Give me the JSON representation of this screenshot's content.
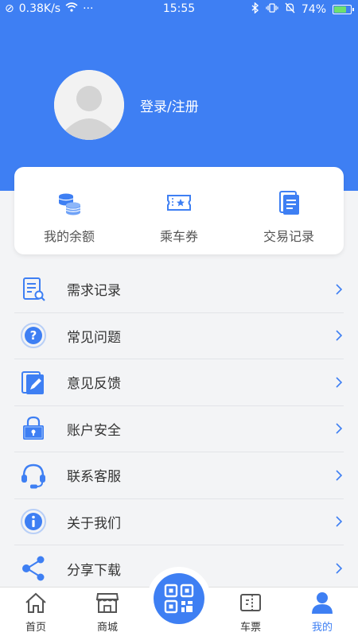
{
  "status_bar": {
    "speed": "0.38K/s",
    "time": "15:55",
    "battery": "74%",
    "battery_level": 0.74
  },
  "profile": {
    "login_label": "登录/注册"
  },
  "wallet": [
    {
      "label": "我的余额",
      "icon": "coins-icon"
    },
    {
      "label": "乘车券",
      "icon": "ticket-icon"
    },
    {
      "label": "交易记录",
      "icon": "document-icon"
    }
  ],
  "menu": [
    {
      "label": "需求记录",
      "icon": "search-document-icon"
    },
    {
      "label": "常见问题",
      "icon": "question-icon"
    },
    {
      "label": "意见反馈",
      "icon": "edit-icon"
    },
    {
      "label": "账户安全",
      "icon": "lock-icon"
    },
    {
      "label": "联系客服",
      "icon": "headset-icon"
    },
    {
      "label": "关于我们",
      "icon": "info-icon"
    },
    {
      "label": "分享下载",
      "icon": "share-icon"
    }
  ],
  "tabs": [
    {
      "label": "首页",
      "icon": "home-icon"
    },
    {
      "label": "商城",
      "icon": "store-icon"
    },
    {
      "label": "车票",
      "icon": "ticket-icon"
    },
    {
      "label": "我的",
      "icon": "user-icon",
      "active": true
    }
  ],
  "colors": {
    "accent": "#3e7ff3"
  }
}
